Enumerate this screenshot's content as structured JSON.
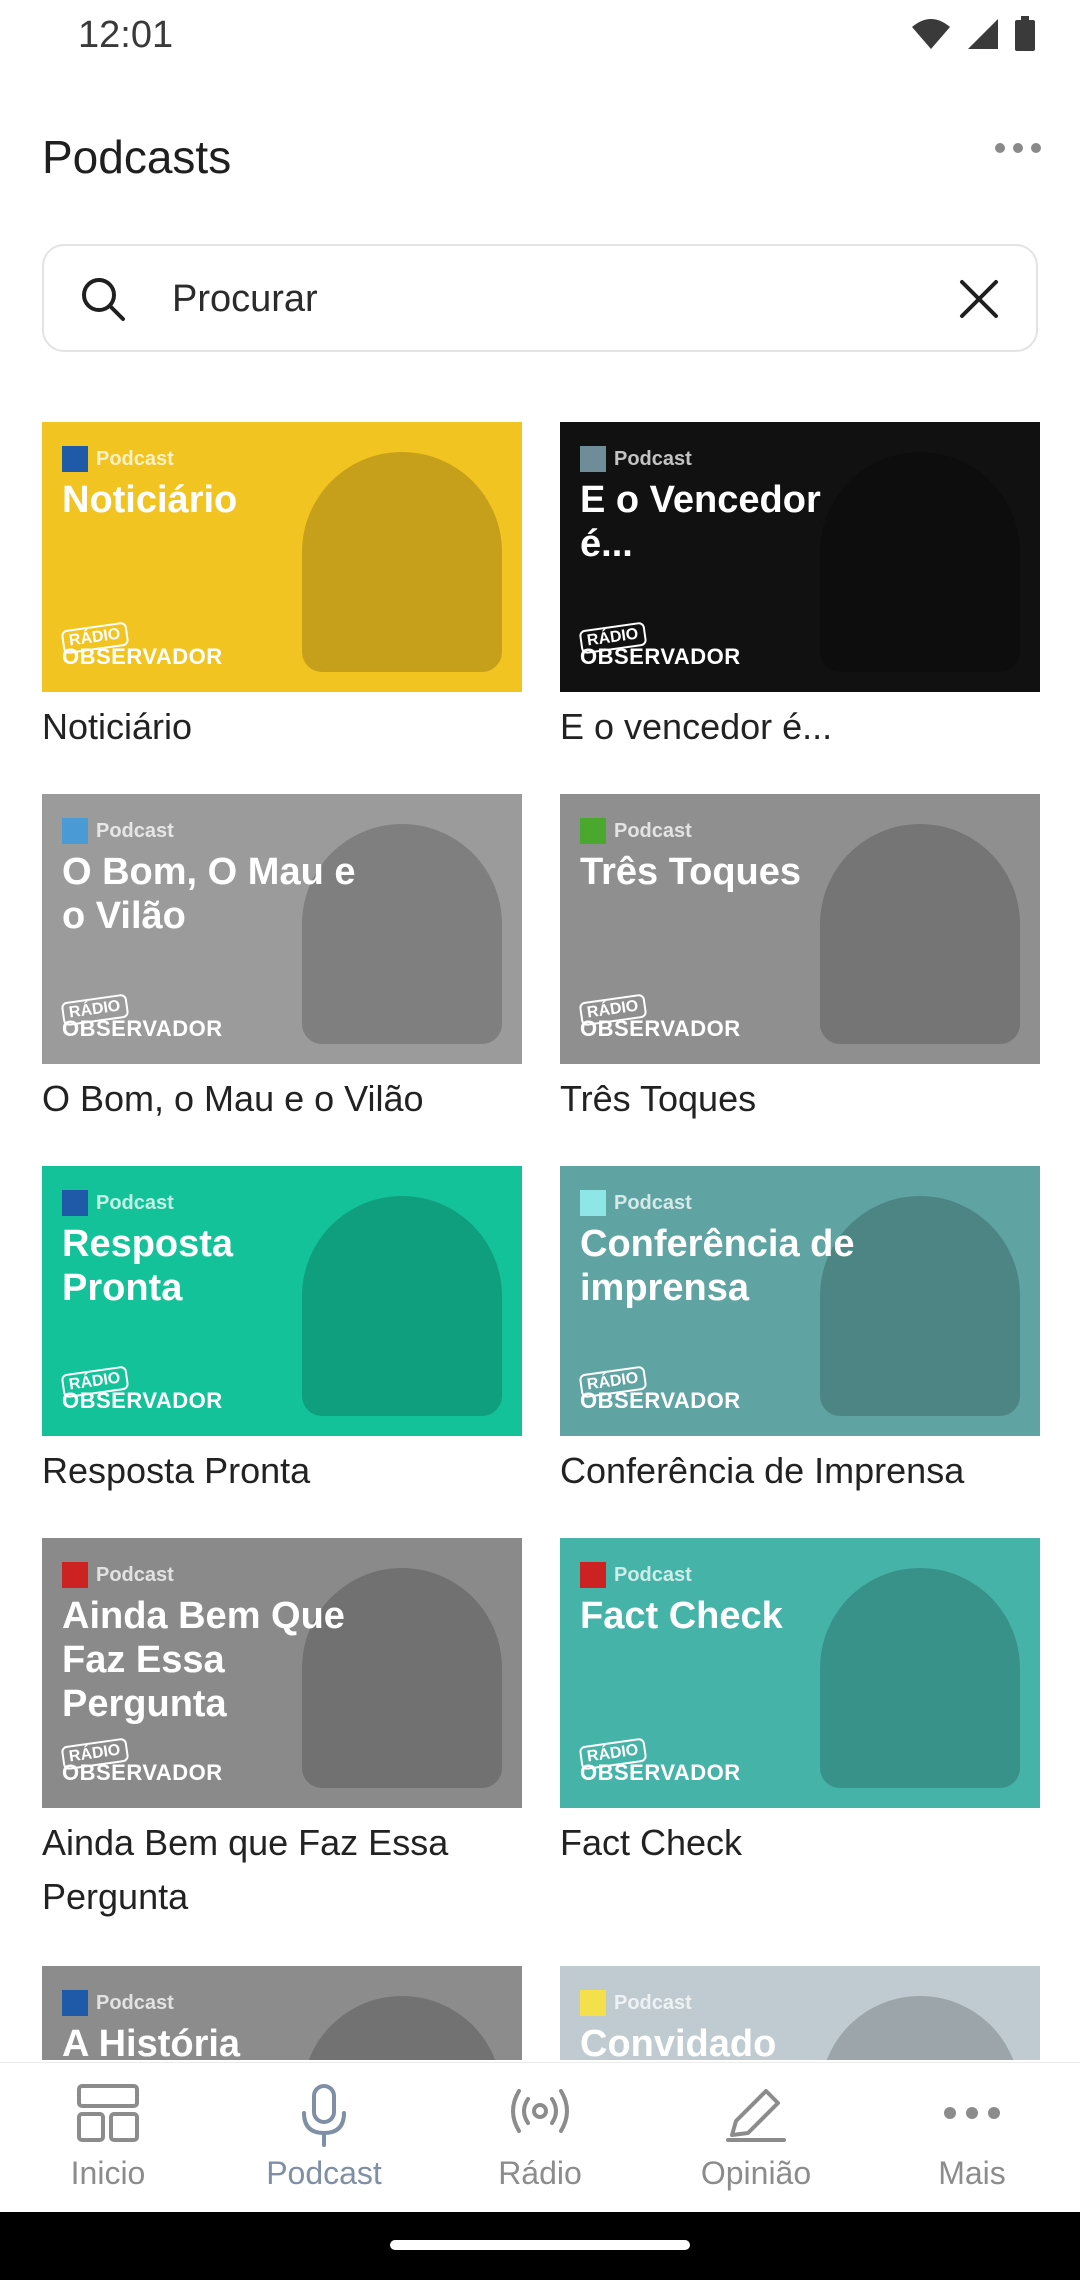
{
  "status_bar": {
    "time": "12:01"
  },
  "header": {
    "title": "Podcasts"
  },
  "search": {
    "placeholder": "Procurar"
  },
  "cover_tag": "Podcast",
  "brand": {
    "line1": "RÁDIO",
    "line2": "OBSERVADOR"
  },
  "podcasts": [
    {
      "title": "Noticiário",
      "cover_title": "Noticiário",
      "bg": "#f2c422",
      "tag_color": "#1e5aa8",
      "art": "headphones-art"
    },
    {
      "title": "E o vencedor é...",
      "cover_title": "E o Vencedor é...",
      "bg": "#111111",
      "tag_color": "#6f8c99",
      "art": "microphones-art"
    },
    {
      "title": "O Bom, o Mau e o Vilão",
      "cover_title": "O Bom, O Mau e o Vilão",
      "bg": "#9b9b9b",
      "tag_color": "#4a9ad6",
      "art": "host-portrait"
    },
    {
      "title": "Três Toques",
      "cover_title": "Três Toques",
      "bg": "#8f8f8f",
      "tag_color": "#4aa82f",
      "art": "hosts-group-photo"
    },
    {
      "title": "Resposta Pronta",
      "cover_title": "Resposta Pronta",
      "bg": "#14c29a",
      "tag_color": "#1e5aa8",
      "art": "blue-microphone-art"
    },
    {
      "title": "Conferência de Imprensa",
      "cover_title": "Conferência de imprensa",
      "bg": "#5fa3a3",
      "tag_color": "#8fe6e6",
      "art": "laptop-newspapers-art"
    },
    {
      "title": "Ainda Bem que Faz Essa Pergunta",
      "cover_title": "Ainda Bem Que Faz Essa Pergunta",
      "bg": "#8a8a8a",
      "tag_color": "#cc2222",
      "art": "two-hosts-photo"
    },
    {
      "title": "Fact Check",
      "cover_title": "Fact Check",
      "bg": "#46b3a9",
      "tag_color": "#cc2222",
      "art": "gauge-art"
    },
    {
      "title": "",
      "cover_title": "A História",
      "bg": "#8c8c8c",
      "tag_color": "#1e5aa8",
      "art": "portrait-art"
    },
    {
      "title": "",
      "cover_title": "Convidado",
      "bg": "#bfcbd0",
      "tag_color": "#f4e04a",
      "art": "chair-art"
    }
  ],
  "bottom_nav": [
    {
      "label": "Inicio",
      "icon": "dashboard-icon",
      "active": false
    },
    {
      "label": "Podcast",
      "icon": "microphone-icon",
      "active": true
    },
    {
      "label": "Rádio",
      "icon": "broadcast-icon",
      "active": false
    },
    {
      "label": "Opinião",
      "icon": "pen-icon",
      "active": false
    },
    {
      "label": "Mais",
      "icon": "more-horizontal-icon",
      "active": false
    }
  ],
  "colors": {
    "nav_active": "#7f8fa6",
    "nav_inactive": "#8c8c8c",
    "text": "#1f1f1f"
  }
}
